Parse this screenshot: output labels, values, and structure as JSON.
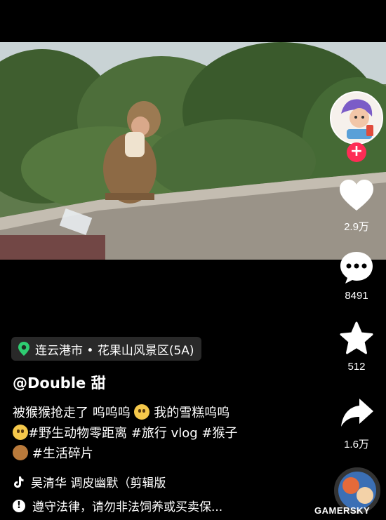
{
  "location": {
    "text": "连云港市 • 花果山风景区(5A)",
    "icon": "location-pin-icon"
  },
  "author": {
    "name": "@Double 甜"
  },
  "description": {
    "line1": "被猴猴抢走了 呜呜呜",
    "line1b": "我的雪糕呜呜",
    "line2": "#野生动物零距离 #旅行 vlog #猴子",
    "line3": "#生活碎片"
  },
  "music": {
    "text": "吴清华    调皮幽默（剪辑版",
    "icon": "tiktok-note-icon"
  },
  "notice": {
    "text": "遵守法律，请勿非法饲养或买卖保...",
    "icon": "info-icon"
  },
  "actions": {
    "likes": "2.9万",
    "comments": "8491",
    "favorites": "512",
    "shares": "1.6万"
  },
  "follow_symbol": "+",
  "watermark": "GAMERSKY",
  "colors": {
    "background": "#000000",
    "follow": "#fe2c55",
    "pin": "#2ecc71"
  }
}
